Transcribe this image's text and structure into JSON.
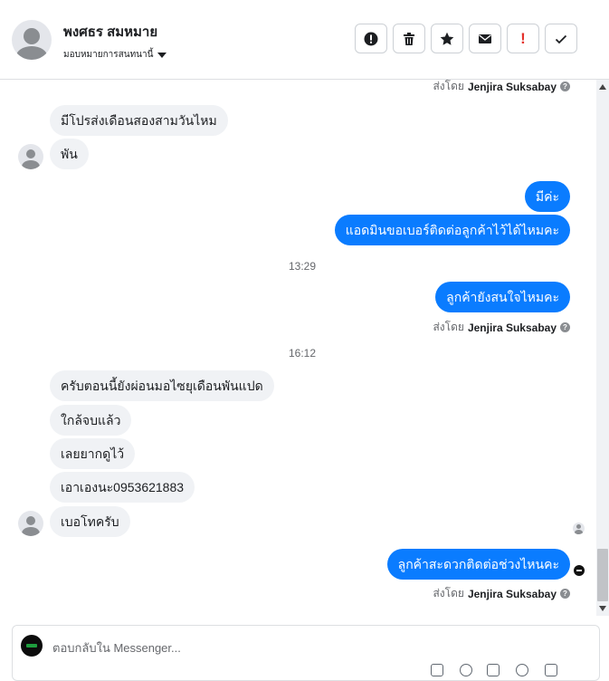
{
  "header": {
    "contact_name": "พงศธร สมหมาย",
    "assign_label": "มอบหมายการสนทนานี้",
    "tools": [
      {
        "icon": "report-icon",
        "label": "Mark as spam"
      },
      {
        "icon": "trash-icon",
        "label": "Delete"
      },
      {
        "icon": "star-icon",
        "label": "Star"
      },
      {
        "icon": "envelope-icon",
        "label": "Mark unread"
      },
      {
        "icon": "exclamation-icon",
        "label": "!"
      },
      {
        "icon": "checkmark-icon",
        "label": "Done"
      }
    ]
  },
  "messages": {
    "sent_by_prefix": "ส่งโดย",
    "agent_name": "Jenjira Suksabay",
    "incoming_1": [
      "มีโปรส่งเดือนสองสามวันไหม",
      "พัน"
    ],
    "outgoing_1": [
      "มีค่ะ",
      "แอดมินขอเบอร์ติดต่อลูกค้าไว้ได้ไหมคะ"
    ],
    "time_1": "13:29",
    "outgoing_2": [
      "ลูกค้ายังสนใจไหมคะ"
    ],
    "time_2": "16:12",
    "incoming_2": [
      "ครับตอนนี้ยังผ่อนมอไซยุเดือนพันแปด",
      "ใกล้จบแล้ว",
      "เลยยากดูไว้",
      "เอาเองนะ0953621883",
      "เบอโทครับ"
    ],
    "outgoing_3": [
      "ลูกค้าสะดวกติดต่อช่วงไหนคะ"
    ]
  },
  "composer": {
    "placeholder": "ตอบกลับใน Messenger..."
  },
  "colors": {
    "outgoing_bubble": "#0a7cff",
    "incoming_bubble": "#f0f2f5"
  }
}
